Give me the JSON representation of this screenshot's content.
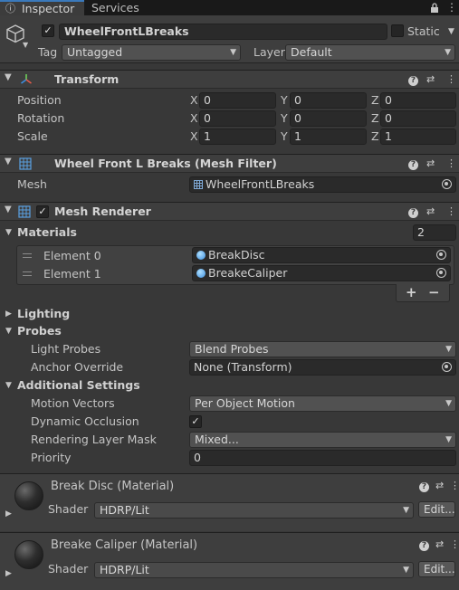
{
  "tabs": {
    "inspector": "Inspector",
    "services": "Services"
  },
  "object": {
    "name": "WheelFrontLBreaks",
    "static_label": "Static",
    "tag_label": "Tag",
    "tag_value": "Untagged",
    "layer_label": "Layer",
    "layer_value": "Default"
  },
  "transform": {
    "title": "Transform",
    "rows": [
      {
        "label": "Position",
        "x": "0",
        "y": "0",
        "z": "0"
      },
      {
        "label": "Rotation",
        "x": "0",
        "y": "0",
        "z": "0"
      },
      {
        "label": "Scale",
        "x": "1",
        "y": "1",
        "z": "1"
      }
    ],
    "axes": {
      "x": "X",
      "y": "Y",
      "z": "Z"
    }
  },
  "mesh_filter": {
    "title": "Wheel Front L Breaks (Mesh Filter)",
    "mesh_label": "Mesh",
    "mesh_value": "WheelFrontLBreaks"
  },
  "mesh_renderer": {
    "title": "Mesh Renderer",
    "materials_label": "Materials",
    "materials_count": "2",
    "elements": [
      {
        "label": "Element 0",
        "value": "BreakDisc"
      },
      {
        "label": "Element 1",
        "value": "BreakeCaliper"
      }
    ],
    "plus": "+",
    "minus": "−",
    "lighting_label": "Lighting",
    "probes_label": "Probes",
    "light_probes_label": "Light Probes",
    "light_probes_value": "Blend Probes",
    "anchor_label": "Anchor Override",
    "anchor_value": "None (Transform)",
    "additional_label": "Additional Settings",
    "motion_label": "Motion Vectors",
    "motion_value": "Per Object Motion",
    "occlusion_label": "Dynamic Occlusion",
    "rlm_label": "Rendering Layer Mask",
    "rlm_value": "Mixed...",
    "priority_label": "Priority",
    "priority_value": "0"
  },
  "materials": [
    {
      "title": "Break Disc (Material)",
      "shader_label": "Shader",
      "shader_value": "HDRP/Lit",
      "edit_label": "Edit..."
    },
    {
      "title": "Breake Caliper (Material)",
      "shader_label": "Shader",
      "shader_value": "HDRP/Lit",
      "edit_label": "Edit..."
    }
  ],
  "icons": {
    "inspector_tab": "info-icon",
    "lock": "lock-icon",
    "menu": "kebab-menu-icon",
    "help": "help-icon",
    "presets": "sliders-icon",
    "gameobject": "cube-icon",
    "transform": "transform-gizmo-icon",
    "mesh": "grid-mesh-icon",
    "picker": "object-picker-icon"
  },
  "colors": {
    "accent": "#3a79bb",
    "panel": "#383838",
    "header": "#3e3e3e",
    "field": "#2a2a2a"
  }
}
